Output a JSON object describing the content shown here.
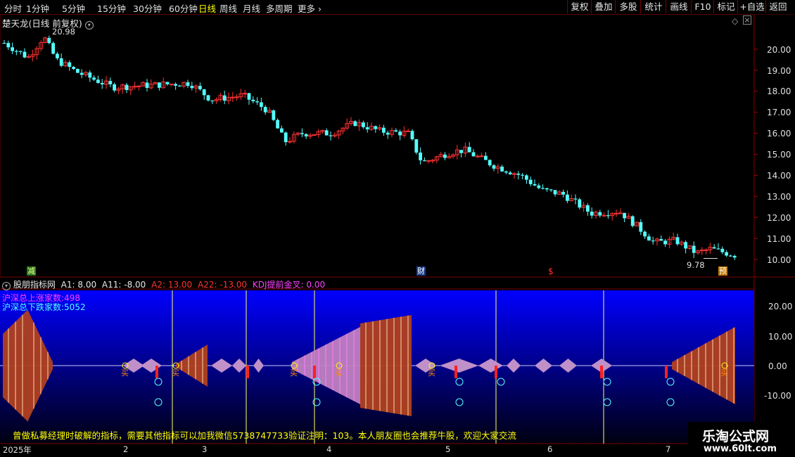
{
  "toolbar": {
    "periods": [
      "分时",
      "1分钟",
      "5分钟",
      "15分钟",
      "30分钟",
      "60分钟",
      "日线",
      "周线",
      "月线",
      "多周期",
      "更多"
    ],
    "active_period": "日线",
    "more_icon": "chevron-right-icon",
    "right_buttons": [
      "复权",
      "叠加",
      "多股",
      "统计",
      "画线",
      "F10",
      "标记",
      "+自选",
      "返回"
    ]
  },
  "main_chart": {
    "title": "楚天龙(日线 前复权)",
    "high_label": "20.98",
    "low_label": "9.78",
    "y_ticks": [
      "20.00",
      "19.00",
      "18.00",
      "17.00",
      "16.00",
      "15.00",
      "14.00",
      "13.00",
      "12.00",
      "11.00",
      "10.00"
    ],
    "markers": [
      "减",
      "财",
      "$",
      "预"
    ],
    "colors": {
      "up": "#ff3232",
      "down": "#54ffff",
      "grid": "#7a0000",
      "axis_text": "#e0e0e0"
    }
  },
  "indicator": {
    "name": "股朋指标网",
    "params": [
      {
        "text": "A1: 8.00",
        "color": "#e0e0e0"
      },
      {
        "text": "A11: -8.00",
        "color": "#e0e0e0"
      },
      {
        "text": "A2: 13.00",
        "color": "#ff3232"
      },
      {
        "text": "A22: -13.00",
        "color": "#ff3232"
      },
      {
        "text": "KDJ提前金叉: 0.00",
        "color": "#ff40ff"
      }
    ],
    "stat_up": "沪深总上涨家数:498",
    "stat_down": "沪深总下跌家数:5052",
    "y_ticks": [
      "20.00",
      "10.00",
      "0.00",
      "-10.00"
    ],
    "footer_text": "曾做私募经理时破解的指标，需要其他指标可以加我微信5738747733验证注明：103。本人朋友圈也会推荐牛股，欢迎大家交流",
    "signal_label": "买"
  },
  "x_axis": {
    "labels": [
      "2025年",
      "2",
      "3",
      "4",
      "5",
      "6",
      "7"
    ]
  },
  "watermark": {
    "line1": "乐淘公式网",
    "line2": "www.60lt.com"
  }
}
